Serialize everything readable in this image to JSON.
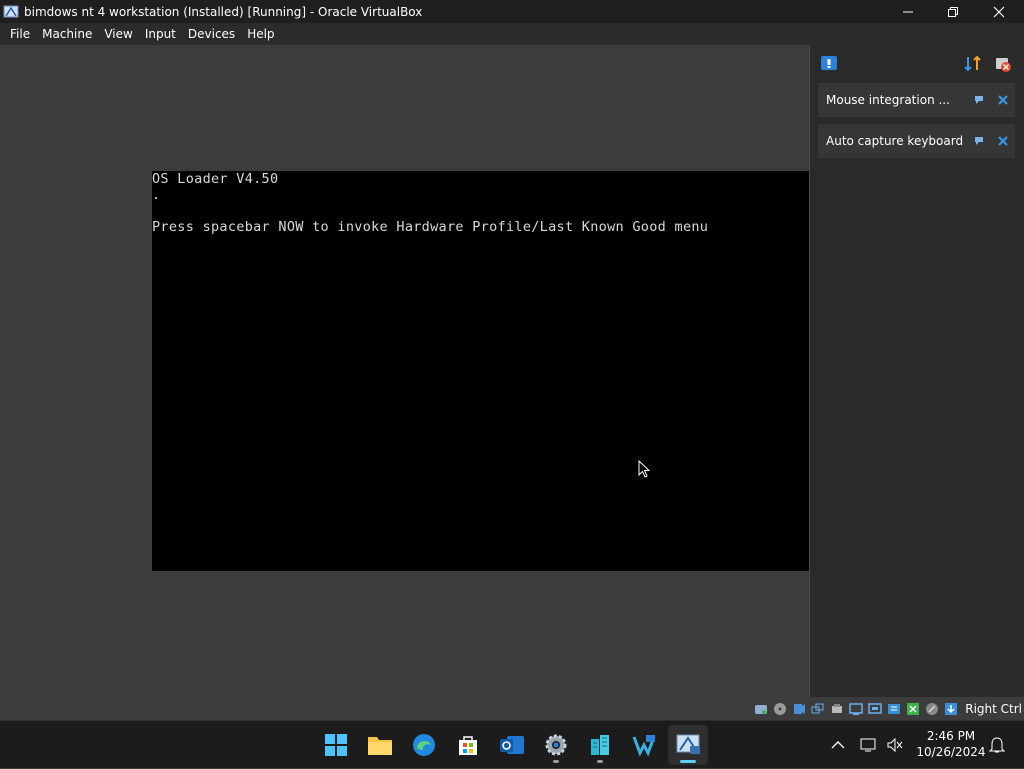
{
  "window": {
    "title": "bimdows nt 4 workstation (Installed) [Running] - Oracle VirtualBox",
    "controls": [
      "minimize",
      "restore",
      "close"
    ]
  },
  "menu": [
    "File",
    "Machine",
    "View",
    "Input",
    "Devices",
    "Help"
  ],
  "vm_screen": {
    "lines": [
      "OS Loader V4.50",
      ".",
      "Press spacebar NOW to invoke Hardware Profile/Last Known Good menu"
    ]
  },
  "notifications": [
    {
      "label": "Mouse integration ..."
    },
    {
      "label": "Auto capture keyboard ..."
    }
  ],
  "statusbar": {
    "host_key": "Right Ctrl",
    "icons": [
      "hard-disk-icon",
      "optical-drive-icon",
      "audio-icon",
      "network-icon",
      "usb-icon",
      "shared-folders-icon",
      "display-icon",
      "video-capture-icon",
      "virtualization-icon",
      "mouse-integration-icon",
      "keyboard-capture-icon"
    ]
  },
  "taskbar": {
    "apps": [
      "start",
      "file-explorer",
      "edge",
      "microsoft-store",
      "outlook",
      "settings",
      "app-buildings",
      "visual-studio-code",
      "virtualbox"
    ],
    "time": "2:46 PM",
    "date": "10/26/2024"
  }
}
